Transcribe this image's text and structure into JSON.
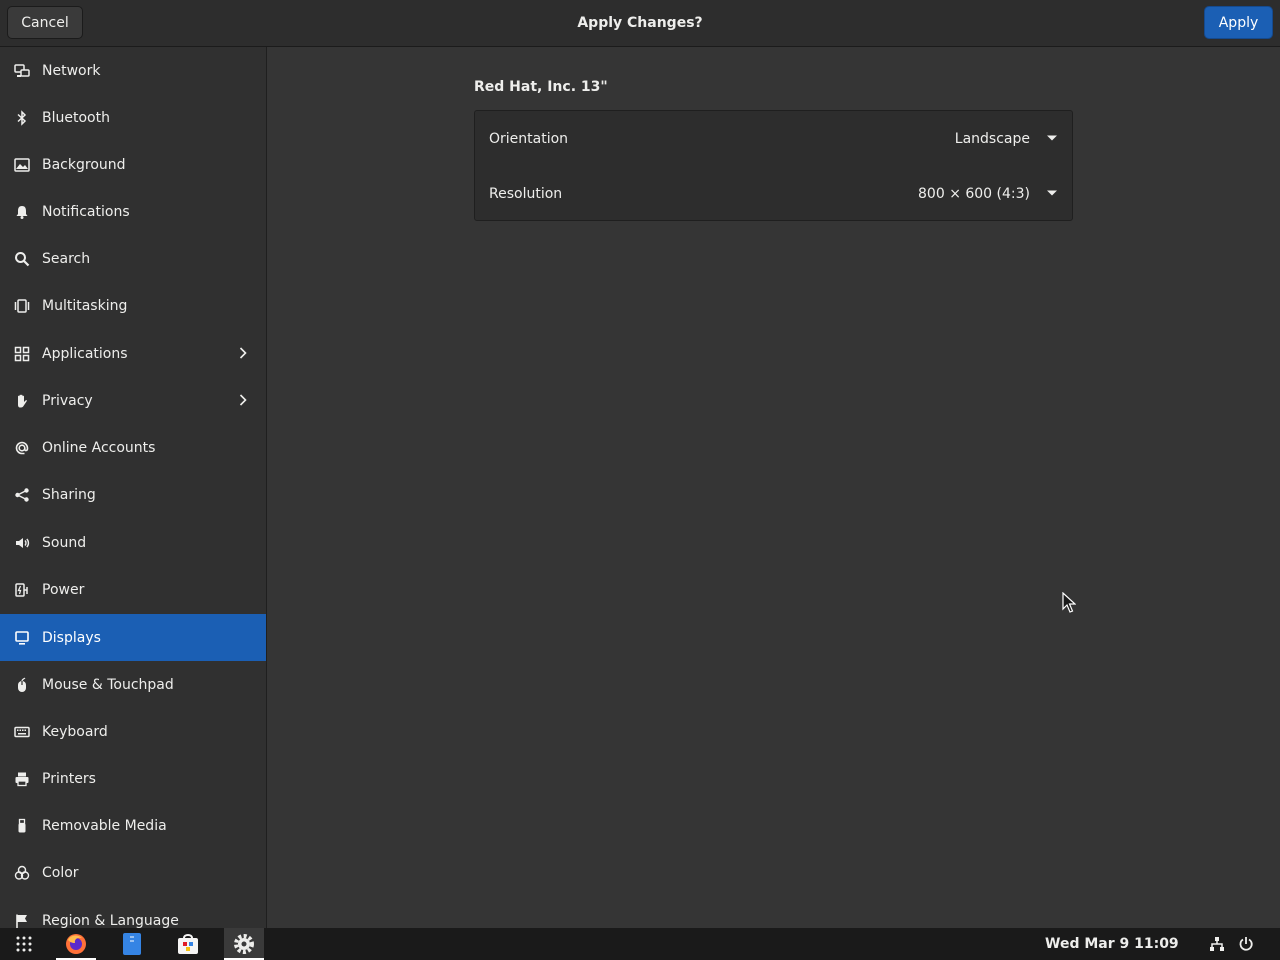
{
  "header": {
    "cancel_label": "Cancel",
    "title": "Apply Changes?",
    "apply_label": "Apply"
  },
  "sidebar": {
    "items": [
      {
        "label": "Network",
        "icon": "network-icon"
      },
      {
        "label": "Bluetooth",
        "icon": "bluetooth-icon"
      },
      {
        "label": "Background",
        "icon": "background-icon"
      },
      {
        "label": "Notifications",
        "icon": "bell-icon"
      },
      {
        "label": "Search",
        "icon": "search-icon"
      },
      {
        "label": "Multitasking",
        "icon": "multitasking-icon"
      },
      {
        "label": "Applications",
        "icon": "applications-icon",
        "has_submenu": true
      },
      {
        "label": "Privacy",
        "icon": "hand-icon",
        "has_submenu": true
      },
      {
        "label": "Online Accounts",
        "icon": "at-icon"
      },
      {
        "label": "Sharing",
        "icon": "share-icon"
      },
      {
        "label": "Sound",
        "icon": "speaker-icon"
      },
      {
        "label": "Power",
        "icon": "power-plug-icon"
      },
      {
        "label": "Displays",
        "icon": "display-icon",
        "active": true
      },
      {
        "label": "Mouse & Touchpad",
        "icon": "mouse-icon"
      },
      {
        "label": "Keyboard",
        "icon": "keyboard-icon"
      },
      {
        "label": "Printers",
        "icon": "printer-icon"
      },
      {
        "label": "Removable Media",
        "icon": "usb-icon"
      },
      {
        "label": "Color",
        "icon": "color-icon"
      },
      {
        "label": "Region & Language",
        "icon": "flag-icon"
      }
    ]
  },
  "display": {
    "monitor_name": "Red Hat, Inc. 13\"",
    "orientation": {
      "label": "Orientation",
      "value": "Landscape"
    },
    "resolution": {
      "label": "Resolution",
      "value": "800 × 600 (4:3)"
    }
  },
  "taskbar": {
    "apps": [
      "app-grid-icon",
      "firefox-icon",
      "files-icon",
      "software-icon",
      "settings-icon"
    ],
    "active_app": "settings-icon",
    "clock": "Wed Mar 9  11:09"
  },
  "colors": {
    "accent": "#1b5fb4",
    "background": "#353535",
    "sidebar": "#303030",
    "taskbar": "#1a1a1a"
  }
}
